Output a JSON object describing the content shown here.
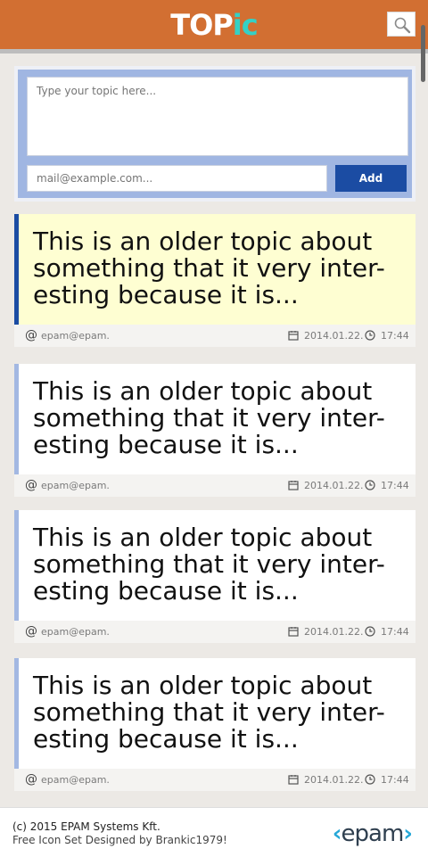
{
  "header": {
    "logo_top": "TOP",
    "logo_ic": "ic"
  },
  "composer": {
    "topic_placeholder": "Type your topic here...",
    "mail_placeholder": "mail@example.com...",
    "add_label": "Add"
  },
  "posts": [
    {
      "text": "This is an older topic about something that it very inter-esting because it is...",
      "author": "epam@epam.",
      "date": "2014.01.22.",
      "time": "17:44"
    },
    {
      "text": "This is an older topic about something that it very inter-esting because it is...",
      "author": "epam@epam.",
      "date": "2014.01.22.",
      "time": "17:44"
    },
    {
      "text": "This is an older topic about something that it very inter-esting because it is...",
      "author": "epam@epam.",
      "date": "2014.01.22.",
      "time": "17:44"
    },
    {
      "text": "This is an older topic about something that it very inter-esting because it is...",
      "author": "epam@epam.",
      "date": "2014.01.22.",
      "time": "17:44"
    }
  ],
  "footer": {
    "copyright": "(c) 2015 EPAM Systems Kft.",
    "credits": "Free Icon Set Designed by Brankic1979!",
    "brand": "epam"
  },
  "colors": {
    "header_bg": "#d26f32",
    "accent": "#1b4ca3",
    "logo_ic": "#34d1c5",
    "highlight_bg": "#fefed2"
  }
}
